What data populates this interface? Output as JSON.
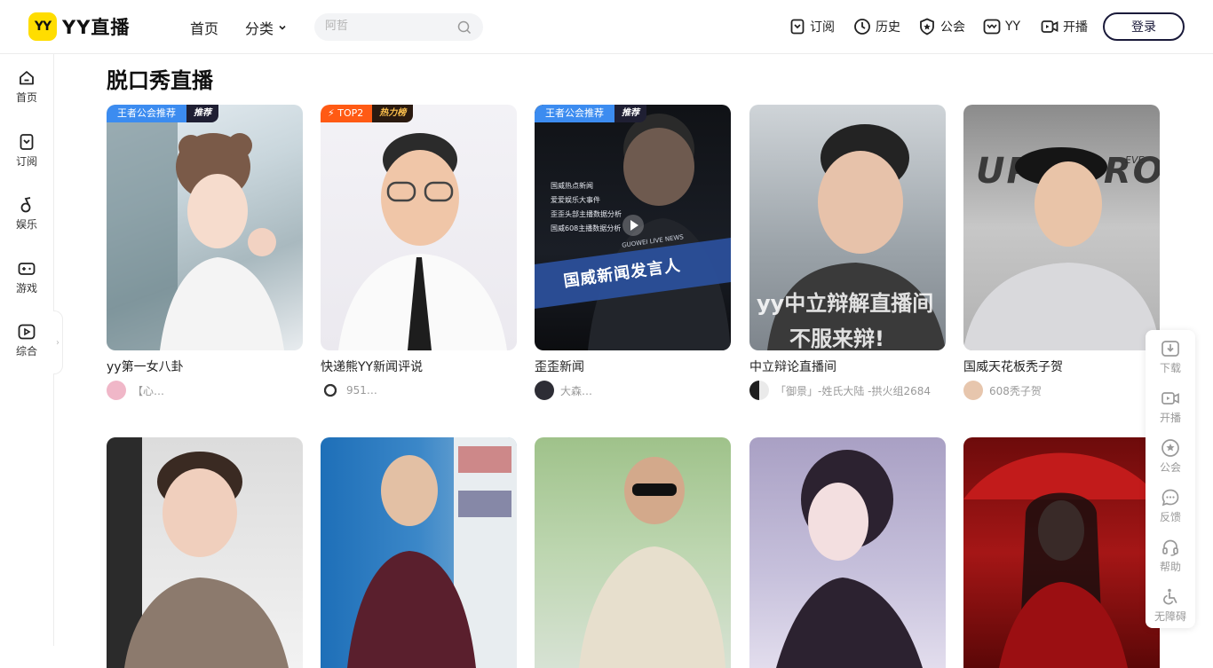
{
  "header": {
    "logo_badge": "YY",
    "logo_text": "YY直播",
    "nav_home": "首页",
    "nav_category": "分类",
    "search_placeholder": "阿哲",
    "actions": [
      {
        "label": "订阅",
        "icon": "bookmark-icon"
      },
      {
        "label": "历史",
        "icon": "clock-icon"
      },
      {
        "label": "公会",
        "icon": "guild-shield-icon"
      },
      {
        "label": "YY",
        "icon": "yy-icon"
      },
      {
        "label": "开播",
        "icon": "camera-icon"
      }
    ],
    "login_label": "登录"
  },
  "sidebar": {
    "items": [
      {
        "label": "首页",
        "icon": "home-icon"
      },
      {
        "label": "订阅",
        "icon": "bookmark-icon"
      },
      {
        "label": "娱乐",
        "icon": "music-note-icon"
      },
      {
        "label": "游戏",
        "icon": "gamepad-icon"
      },
      {
        "label": "综合",
        "icon": "tv-icon"
      }
    ],
    "expand_glyph": "›"
  },
  "main": {
    "section_title": "脱口秀直播",
    "row1": [
      {
        "title": "yy第一女八卦",
        "owner": "【心…",
        "badge_a": "王者公会推荐",
        "badge_b": "推荐"
      },
      {
        "title": "快递熊YY新闻评说",
        "owner": "951…",
        "badge_a": "TOP2",
        "badge_b": "热力榜"
      },
      {
        "title": "歪歪新闻",
        "owner": "大森…",
        "badge_a": "王者公会推荐",
        "badge_b": "推荐",
        "poster_lines": [
          "国威热点新闻",
          "爱爱娱乐大事件",
          "歪歪头部主播数据分析",
          "国威608主播数据分析"
        ],
        "poster_banner": "国威新闻发言人",
        "poster_sub": "GUOWEI LIVE NEWS"
      },
      {
        "title": "中立辩论直播间",
        "owner": "「御景」-姓氏大陆 -拱火组2684",
        "overlay_line1": "yy中立辩解直播间",
        "overlay_line2": "不服来辩!"
      },
      {
        "title": "国威天花板秃子贺",
        "owner": "608秃子贺",
        "poster_text": "UPER RO",
        "poster_small": "EVE"
      }
    ],
    "row2_count": 5
  },
  "float_bar": [
    {
      "label": "下载",
      "icon": "download-icon"
    },
    {
      "label": "开播",
      "icon": "camera-icon"
    },
    {
      "label": "公会",
      "icon": "guild-shield-icon"
    },
    {
      "label": "反馈",
      "icon": "chat-bubble-icon"
    },
    {
      "label": "帮助",
      "icon": "headset-icon"
    },
    {
      "label": "无障碍",
      "icon": "accessibility-icon"
    }
  ],
  "colors": {
    "brand_yellow": "#ffdd00",
    "badge_blue": "#3c8cf0",
    "badge_orange": "#ff5a14",
    "login_border": "#1a1a3a"
  }
}
